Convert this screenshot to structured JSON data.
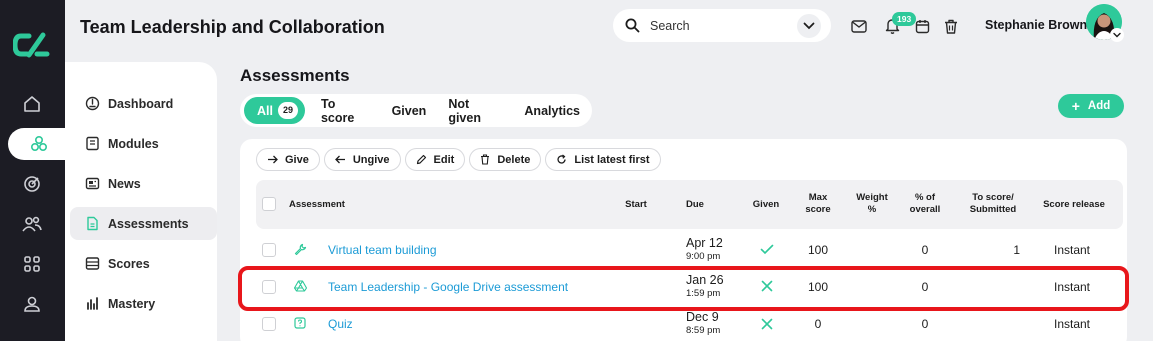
{
  "header": {
    "title": "Team Leadership and Collaboration",
    "search_placeholder": "Search",
    "notification_count": "193",
    "user_name": "Stephanie Brown"
  },
  "rail": {
    "items": [
      "home-icon",
      "modules-cube-icon",
      "target-icon",
      "people-icon",
      "grid-icon",
      "person-icon"
    ],
    "active_index": 1
  },
  "sidebar": {
    "items": [
      {
        "label": "Dashboard",
        "icon": "dashboard-icon"
      },
      {
        "label": "Modules",
        "icon": "book-icon"
      },
      {
        "label": "News",
        "icon": "newspaper-icon"
      },
      {
        "label": "Assessments",
        "icon": "file-icon"
      },
      {
        "label": "Scores",
        "icon": "list-icon"
      },
      {
        "label": "Mastery",
        "icon": "bar-chart-icon"
      }
    ],
    "active_index": 3
  },
  "main": {
    "title": "Assessments",
    "tabs": [
      {
        "label": "All",
        "count": "29"
      },
      {
        "label": "To score"
      },
      {
        "label": "Given"
      },
      {
        "label": "Not given"
      },
      {
        "label": "Analytics"
      }
    ],
    "add_label": "Add",
    "toolbar": {
      "give": "Give",
      "ungive": "Ungive",
      "edit": "Edit",
      "delete": "Delete",
      "sort": "List latest first"
    },
    "columns": {
      "assessment": "Assessment",
      "start": "Start",
      "due": "Due",
      "given": "Given",
      "max_score": "Max\nscore",
      "weight": "Weight\n%",
      "pct_overall": "% of\noverall",
      "to_score": "To score/\nSubmitted",
      "score_release": "Score release"
    },
    "rows": [
      {
        "icon": "wrench-icon",
        "name": "Virtual team building",
        "start": "",
        "due_date": "Apr 12",
        "due_time": "9:00 pm",
        "given": "check",
        "max_score": "100",
        "weight": "",
        "pct_overall": "0",
        "to_score": "1",
        "release": "Instant"
      },
      {
        "icon": "google-drive-icon",
        "name": "Team Leadership - Google Drive assessment",
        "start": "",
        "due_date": "Jan 26",
        "due_time": "1:59 pm",
        "given": "cross",
        "max_score": "100",
        "weight": "",
        "pct_overall": "0",
        "to_score": "",
        "release": "Instant"
      },
      {
        "icon": "quiz-icon",
        "name": "Quiz",
        "start": "",
        "due_date": "Dec 9",
        "due_time": "8:59 pm",
        "given": "cross",
        "max_score": "0",
        "weight": "",
        "pct_overall": "0",
        "to_score": "",
        "release": "Instant"
      }
    ]
  },
  "colors": {
    "accent": "#2ec99a",
    "link": "#1c9bd6",
    "highlight": "#e8161b",
    "rail_bg": "#1c1c24"
  }
}
